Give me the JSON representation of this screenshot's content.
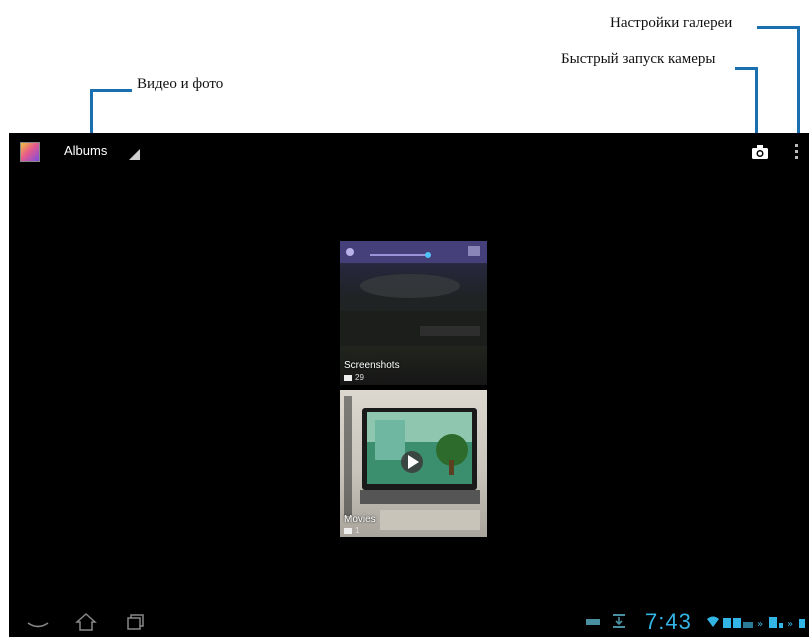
{
  "annotations": {
    "gallery_settings": "Настройки галереи",
    "quick_camera": "Быстрый запуск камеры",
    "video_photo": "Видео и фото"
  },
  "actionbar": {
    "title": "Albums",
    "app_icon": "gallery-app-icon",
    "camera_icon": "camera-icon",
    "menu_icon": "overflow-menu-icon"
  },
  "albums": [
    {
      "name": "Screenshots",
      "count": "29",
      "icon": "folder-icon"
    },
    {
      "name": "Movies",
      "count": "1",
      "icon": "folder-icon"
    }
  ],
  "statusbar": {
    "time": "7:43",
    "nav_icons": [
      "back-icon",
      "home-icon",
      "recent-apps-icon"
    ],
    "status_icons": [
      "keyboard-icon",
      "download-icon",
      "wifi-icon",
      "battery-icon",
      "usb-icon"
    ],
    "accent_color": "#33b5e5"
  },
  "colors": {
    "leader_line": "#1a6fb0",
    "screen_bg": "#000000"
  }
}
